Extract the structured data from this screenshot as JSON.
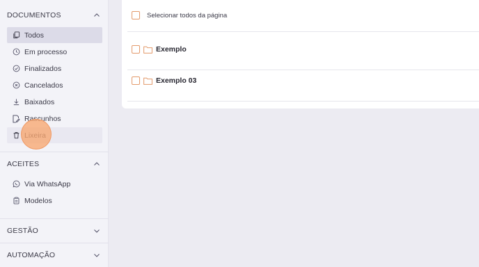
{
  "sidebar": {
    "documentos": {
      "title": "DOCUMENTOS",
      "items": [
        {
          "label": "Todos",
          "icon": "copy-icon"
        },
        {
          "label": "Em processo",
          "icon": "clock-icon"
        },
        {
          "label": "Finalizados",
          "icon": "check-circle-icon"
        },
        {
          "label": "Cancelados",
          "icon": "x-circle-icon"
        },
        {
          "label": "Baixados",
          "icon": "download-icon"
        },
        {
          "label": "Rascunhos",
          "icon": "draft-icon"
        },
        {
          "label": "Lixeira",
          "icon": "trash-icon"
        }
      ]
    },
    "aceites": {
      "title": "ACEITES",
      "items": [
        {
          "label": "Via WhatsApp",
          "icon": "whatsapp-icon"
        },
        {
          "label": "Modelos",
          "icon": "clipboard-icon"
        }
      ]
    },
    "gestao": {
      "title": "GESTÃO"
    },
    "automacao": {
      "title": "AUTOMAÇÃO"
    }
  },
  "main": {
    "select_all_label": "Selecionar todos da página",
    "folders": [
      {
        "name": "Exemplo"
      },
      {
        "name": "Exemplo 03"
      }
    ]
  },
  "colors": {
    "accent": "#e39a6b",
    "active_bg": "#dcdbe8",
    "sidebar_bg": "#f3f3f8",
    "page_bg": "#ecebf2"
  }
}
